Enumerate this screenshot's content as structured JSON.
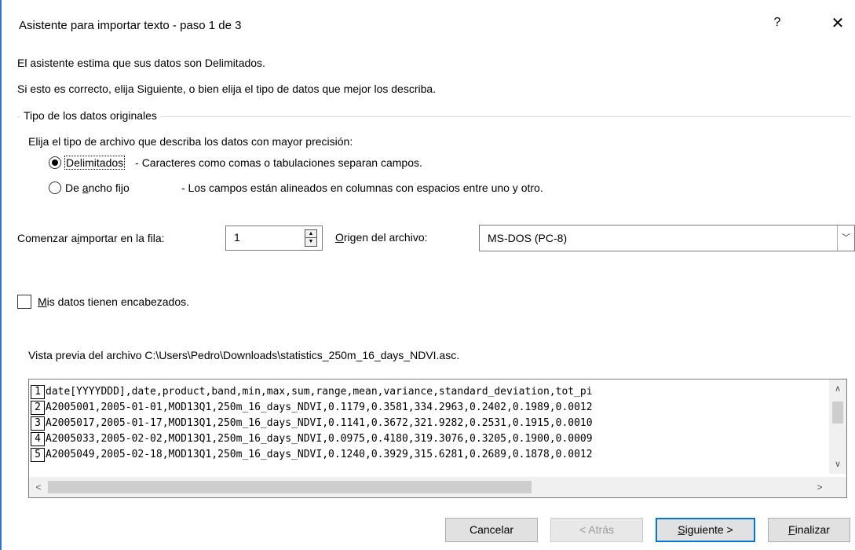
{
  "window": {
    "title": "Asistente para importar texto - paso 1 de 3",
    "help_label": "?",
    "close_label": "✕"
  },
  "intro": {
    "line1": "El asistente estima que sus datos son Delimitados.",
    "line2": "Si esto es correcto, elija Siguiente, o bien elija el tipo de datos que mejor los describa."
  },
  "data_type_group": {
    "legend": "Tipo de los datos originales",
    "prompt": "Elija el tipo de archivo que describa los datos con mayor precisión:",
    "options": [
      {
        "label": "Delimitados",
        "description": "- Caracteres como comas o tabulaciones separan campos.",
        "checked": true
      },
      {
        "label_before": "De ",
        "label_underlined": "a",
        "label_after": "ncho fijo",
        "description": "- Los campos están alineados en columnas con espacios entre uno y otro.",
        "checked": false
      }
    ]
  },
  "start_row": {
    "label_before": "Comenzar a ",
    "label_underlined": "i",
    "label_after": "mportar en la fila:",
    "value": "1"
  },
  "origin": {
    "label_before": "",
    "label_underlined": "O",
    "label_after": "rigen del archivo:",
    "value": "MS-DOS (PC-8)"
  },
  "headers_checkbox": {
    "label_underlined": "M",
    "label_after": "is datos tienen encabezados.",
    "checked": false
  },
  "preview": {
    "caption": "Vista previa del archivo C:\\Users\\Pedro\\Downloads\\statistics_250m_16_days_NDVI.asc.",
    "lines": [
      {
        "num": "1",
        "text": "date[YYYYDDD],date,product,band,min,max,sum,range,mean,variance,standard_deviation,tot_pi"
      },
      {
        "num": "2",
        "text": "A2005001,2005-01-01,MOD13Q1,250m_16_days_NDVI,0.1179,0.3581,334.2963,0.2402,0.1989,0.0012"
      },
      {
        "num": "3",
        "text": "A2005017,2005-01-17,MOD13Q1,250m_16_days_NDVI,0.1141,0.3672,321.9282,0.2531,0.1915,0.0010"
      },
      {
        "num": "4",
        "text": "A2005033,2005-02-02,MOD13Q1,250m_16_days_NDVI,0.0975,0.4180,319.3076,0.3205,0.1900,0.0009"
      },
      {
        "num": "5",
        "text": "A2005049,2005-02-18,MOD13Q1,250m_16_days_NDVI,0.1240,0.3929,315.6281,0.2689,0.1878,0.0012"
      }
    ]
  },
  "buttons": {
    "cancel": "Cancelar",
    "back": "< Atrás",
    "next_underlined": "S",
    "next_after": "iguiente >",
    "finish_underlined": "F",
    "finish_after": "inalizar"
  },
  "icons": {
    "spin_up": "▲",
    "spin_down": "▼",
    "dropdown": "﹀",
    "scroll_up": "∧",
    "scroll_down": "∨",
    "scroll_left": "<",
    "scroll_right": ">"
  }
}
